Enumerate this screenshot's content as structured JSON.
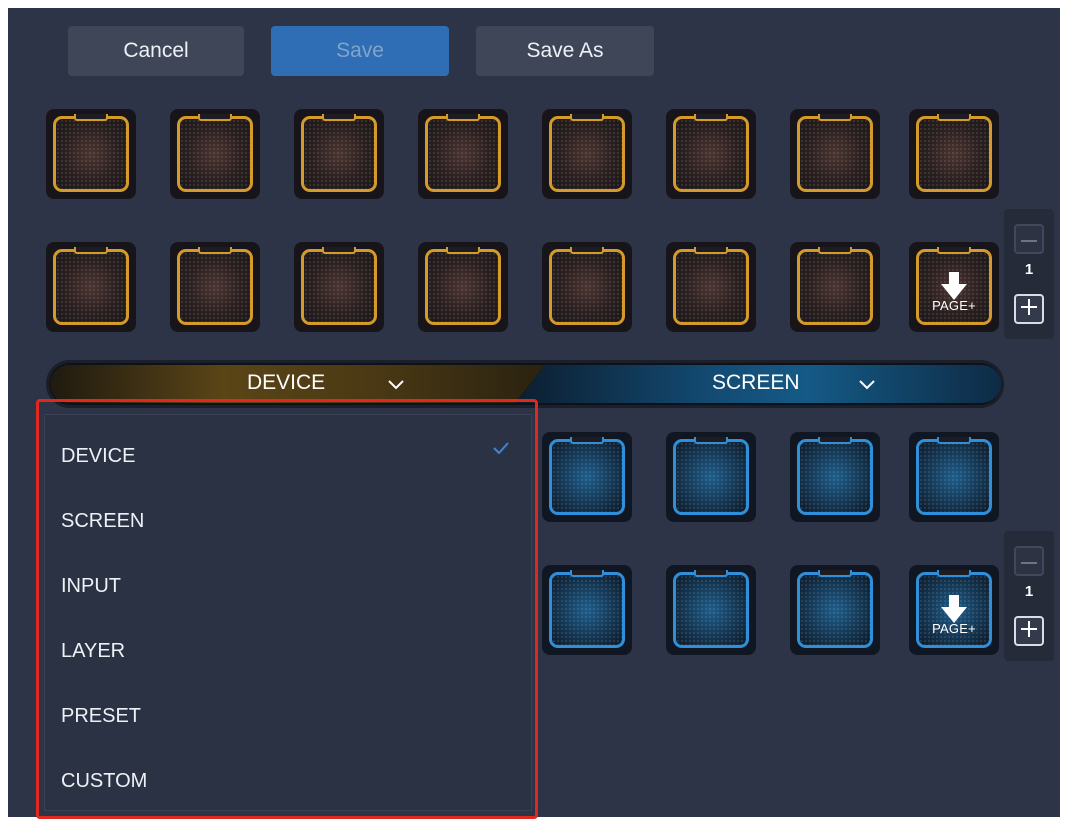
{
  "toolbar": {
    "cancel_label": "Cancel",
    "save_label": "Save",
    "save_as_label": "Save As"
  },
  "device_keys": {
    "page_key_label": "PAGE+",
    "page_number": "1"
  },
  "screen_keys": {
    "page_key_label": "PAGE+",
    "page_number": "1"
  },
  "tabs": {
    "device_label": "DEVICE",
    "screen_label": "SCREEN"
  },
  "dropdown": {
    "items": [
      "DEVICE",
      "SCREEN",
      "INPUT",
      "LAYER",
      "PRESET",
      "CUSTOM"
    ],
    "selected": "DEVICE"
  },
  "colors": {
    "panel_bg": "#2e3447",
    "gold_key": "#d49a2a",
    "blue_key": "#2f8fd8",
    "save_button": "#2f6db5",
    "highlight": "#e0281f"
  },
  "icons": [
    "arrow-down-icon",
    "chevron-down-icon",
    "check-icon",
    "minus-icon",
    "plus-icon"
  ]
}
